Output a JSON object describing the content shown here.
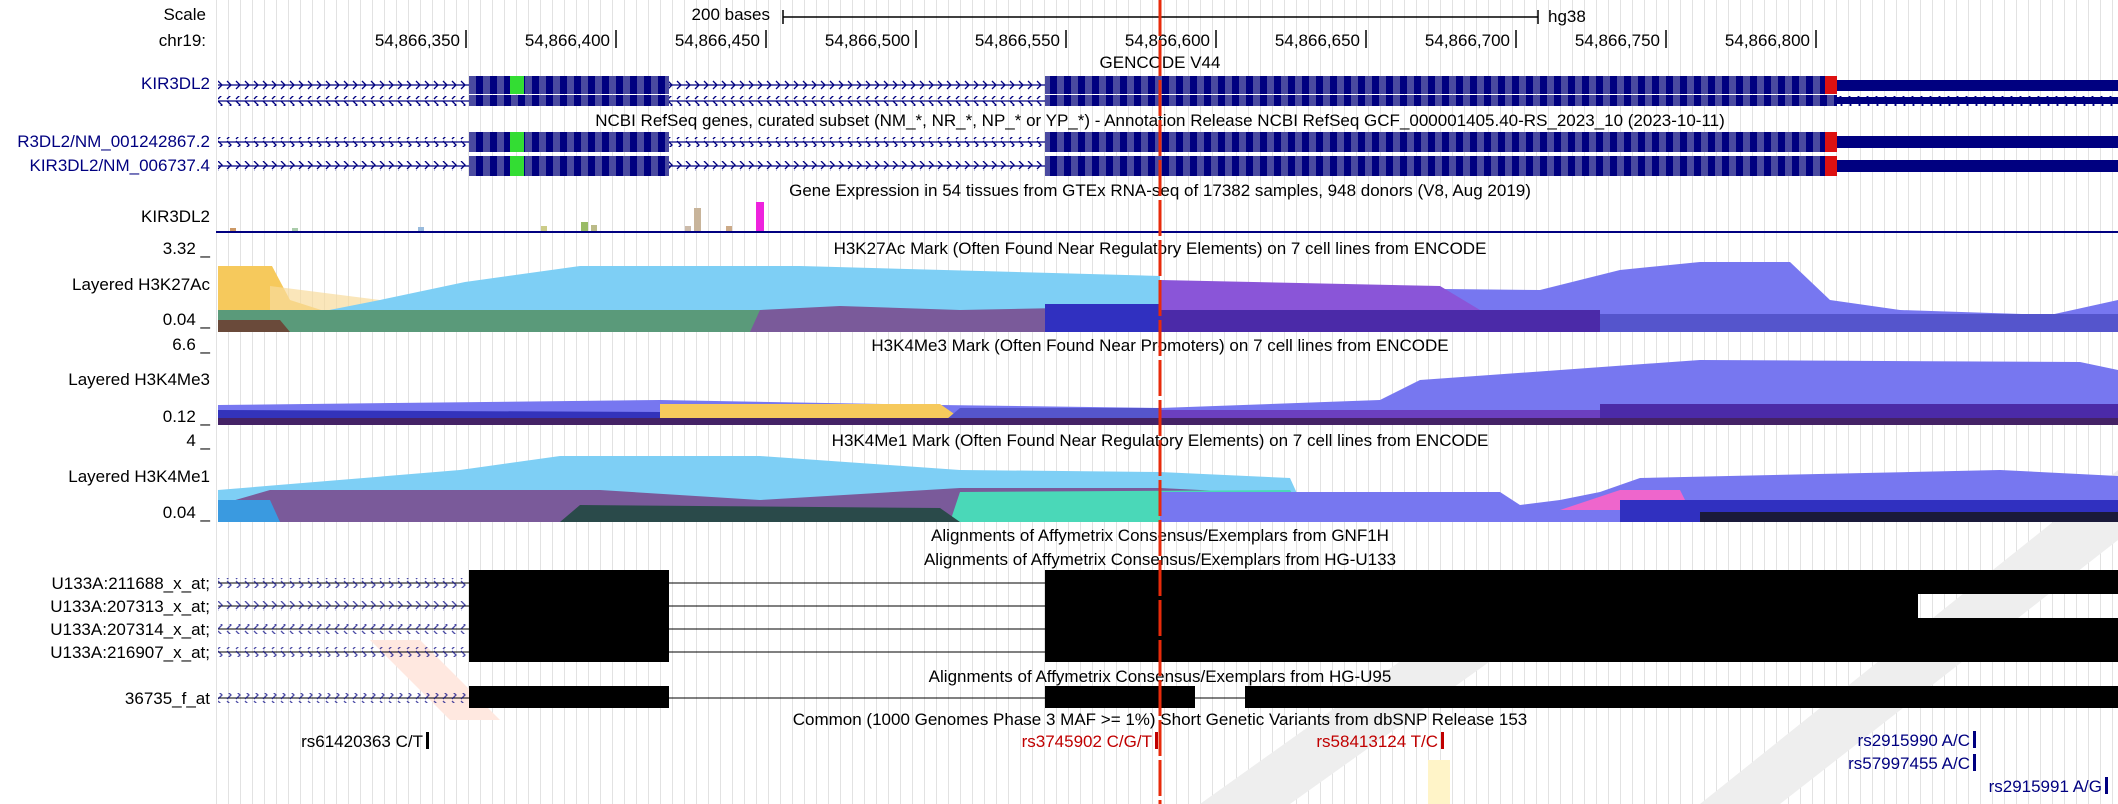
{
  "genome": "hg38",
  "scale": {
    "label": "Scale",
    "bar_label": "200 bases"
  },
  "ruler": {
    "chrom_label": "chr19:",
    "ticks": [
      "54,866,350",
      "54,866,400",
      "54,866,450",
      "54,866,500",
      "54,866,550",
      "54,866,600",
      "54,866,650",
      "54,866,700",
      "54,866,750",
      "54,866,800"
    ]
  },
  "tracks": {
    "gencode": {
      "title": "GENCODE V44",
      "label": "KIR3DL2"
    },
    "refseq": {
      "title": "NCBI RefSeq genes, curated subset (NM_*, NR_*, NP_* or YP_*) - Annotation Release NCBI RefSeq GCF_000001405.40-RS_2023_10 (2023-10-11)",
      "label1": "R3DL2/NM_001242867.2",
      "label2": "KIR3DL2/NM_006737.4"
    },
    "gtex": {
      "title": "Gene Expression in 54 tissues from GTEx RNA-seq of 17382 samples, 948 donors (V8, Aug 2019)",
      "label": "KIR3DL2"
    },
    "h3k27ac": {
      "title": "H3K27Ac Mark (Often Found Near Regulatory Elements) on 7 cell lines from ENCODE",
      "label": "Layered H3K27Ac",
      "max": "3.32 _",
      "min": "0.04 _"
    },
    "h3k4me3": {
      "title": "H3K4Me3 Mark (Often Found Near Promoters) on 7 cell lines from ENCODE",
      "label": "Layered H3K4Me3",
      "max": "6.6 _",
      "min": "0.12 _"
    },
    "h3k4me1": {
      "title": "H3K4Me1 Mark (Often Found Near Regulatory Elements) on 7 cell lines from ENCODE",
      "label": "Layered H3K4Me1",
      "max": "4 _",
      "min": "0.04 _"
    },
    "gnf1h": {
      "title": "Alignments of Affymetrix Consensus/Exemplars from GNF1H"
    },
    "hgu133": {
      "title": "Alignments of Affymetrix Consensus/Exemplars from HG-U133",
      "items": [
        "U133A:211688_x_at;",
        "U133A:207313_x_at;",
        "U133A:207314_x_at;",
        "U133A:216907_x_at;"
      ]
    },
    "hgu95": {
      "title": "Alignments of Affymetrix Consensus/Exemplars from HG-U95",
      "item": "36735_f_at"
    },
    "dbsnp": {
      "title": "Common (1000 Genomes Phase 3 MAF >= 1%) Short Genetic Variants from dbSNP Release 153",
      "variants": [
        "rs61420363 C/T",
        "rs3745902 C/G/T",
        "rs58413124 T/C",
        "rs2915990 A/C",
        "rs57997455 A/C",
        "rs2915991 A/G"
      ]
    }
  },
  "colors": {
    "gene": "#000080",
    "cds_highlight": "#33dd33",
    "stop_codon": "#dd1111",
    "cursor": "#e82a0a",
    "snp_red": "#c00000",
    "snp_blue": "#000080"
  }
}
